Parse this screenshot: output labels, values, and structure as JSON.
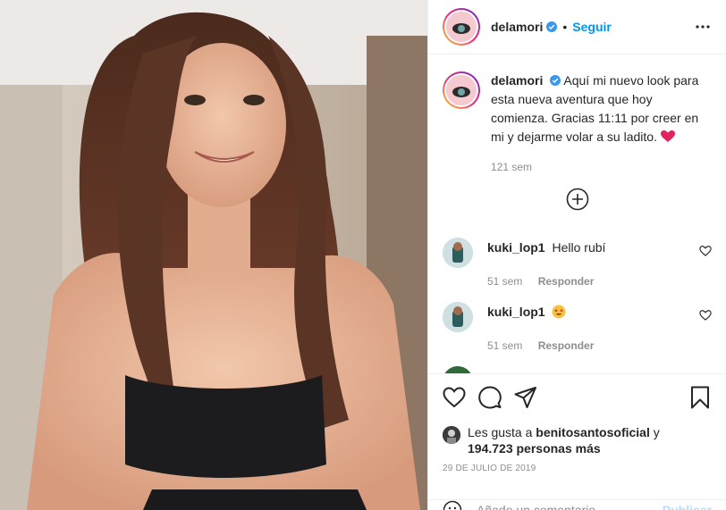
{
  "post": {
    "username": "delamori",
    "follow_label": "Seguir",
    "dot": "•",
    "caption": "Aquí mi nuevo look para esta nueva aventura que hoy comienza. Gracias 11:11 por creer en mi y dejarme volar a su ladito.",
    "caption_time": "121 sem"
  },
  "comments": [
    {
      "username": "kuki_lop1",
      "text": "Hello rubí",
      "time": "51 sem",
      "reply_label": "Responder"
    },
    {
      "username": "kuki_lop1",
      "text": "",
      "time": "51 sem",
      "reply_label": "Responder"
    }
  ],
  "likes": {
    "prefix": "Les gusta a",
    "user": "benitosantosoficial",
    "connector": "y",
    "count": "194.723 personas más"
  },
  "date": "29 DE JULIO DE 2019",
  "add_comment": {
    "placeholder": "Añade un comentario...",
    "publish_label": "Publicar"
  },
  "icons": {
    "more": "more-options-icon",
    "heart": "heart-icon",
    "comment": "comment-icon",
    "share": "share-icon",
    "save": "bookmark-icon",
    "add": "plus-circle-icon",
    "verified": "verified-badge-icon",
    "emoji": "emoji-icon"
  },
  "colors": {
    "accent": "#0095f6",
    "verified": "#3897f0",
    "heart_red": "#ed4956",
    "muted": "#8e8e8e"
  }
}
